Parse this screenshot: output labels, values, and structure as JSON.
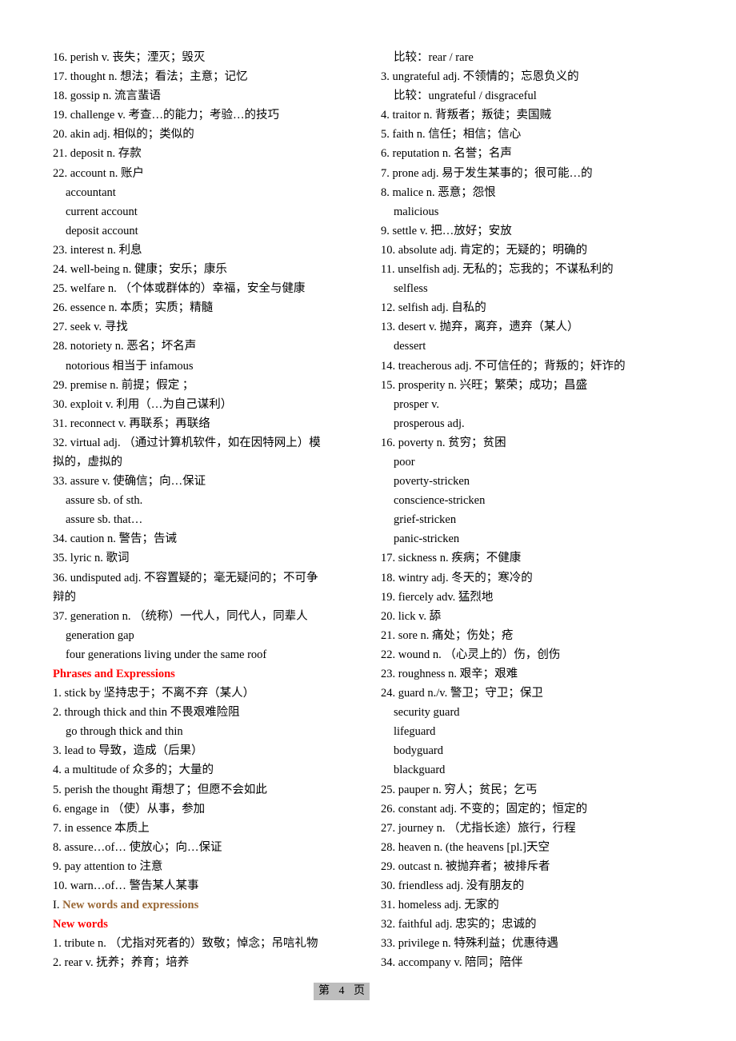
{
  "left_column": [
    {
      "type": "entry",
      "text": "16. perish v.  丧失；湮灭；毁灭"
    },
    {
      "type": "entry",
      "text": "17. thought n.  想法；看法；主意；记忆"
    },
    {
      "type": "entry",
      "text": "18. gossip n.  流言蜚语"
    },
    {
      "type": "entry",
      "text": "19. challenge v.  考查…的能力；考验…的技巧"
    },
    {
      "type": "entry",
      "text": "20. akin adj.  相似的；类似的"
    },
    {
      "type": "entry",
      "text": "21. deposit n.  存款"
    },
    {
      "type": "entry",
      "text": "22. account n.  账户"
    },
    {
      "type": "sub",
      "text": "accountant"
    },
    {
      "type": "sub",
      "text": "current account"
    },
    {
      "type": "sub",
      "text": "deposit account"
    },
    {
      "type": "entry",
      "text": "23. interest n.  利息"
    },
    {
      "type": "entry",
      "text": "24. well-being n.  健康；安乐；康乐"
    },
    {
      "type": "entry",
      "text": "25. welfare n.  （个体或群体的）幸福，安全与健康"
    },
    {
      "type": "entry",
      "text": "26. essence n.  本质；实质；精髓"
    },
    {
      "type": "entry",
      "text": "27. seek v.  寻找"
    },
    {
      "type": "entry",
      "text": "28. notoriety n.  恶名；坏名声"
    },
    {
      "type": "sub",
      "text": "notorious  相当于 infamous"
    },
    {
      "type": "entry",
      "text": "29. premise n.  前提；假定  ；"
    },
    {
      "type": "entry",
      "text": "30. exploit v.  利用（…为自己谋利）"
    },
    {
      "type": "entry",
      "text": "31. reconnect v.  再联系；再联络"
    },
    {
      "type": "entry",
      "text": "32. virtual adj.  （通过计算机软件，如在因特网上）模"
    },
    {
      "type": "cont",
      "text": "拟的，虚拟的"
    },
    {
      "type": "entry",
      "text": "33. assure v.  使确信；向…保证"
    },
    {
      "type": "sub",
      "text": "assure sb. of sth."
    },
    {
      "type": "sub",
      "text": "assure sb. that…"
    },
    {
      "type": "entry",
      "text": "34. caution n.  警告；告诫"
    },
    {
      "type": "entry",
      "text": "35. lyric n.  歌词"
    },
    {
      "type": "entry",
      "text": "36. undisputed adj.  不容置疑的；毫无疑问的；不可争"
    },
    {
      "type": "cont",
      "text": "辩的"
    },
    {
      "type": "entry",
      "text": "37. generation n.  （统称）一代人，同代人，同辈人"
    },
    {
      "type": "sub",
      "text": "generation gap"
    },
    {
      "type": "sub",
      "text": "four generations living under the same roof"
    },
    {
      "type": "heading-red",
      "text": "Phrases and Expressions"
    },
    {
      "type": "entry",
      "text": "1. stick by  坚持忠于；不离不弃（某人）"
    },
    {
      "type": "entry",
      "text": "2. through thick and thin  不畏艰难险阻"
    },
    {
      "type": "sub",
      "text": "go through thick and thin"
    },
    {
      "type": "entry",
      "text": "3. lead to  导致，造成（后果）"
    },
    {
      "type": "entry",
      "text": "4. a multitude of  众多的；大量的"
    },
    {
      "type": "entry",
      "text": "5. perish the thought  甭想了；但愿不会如此"
    },
    {
      "type": "entry",
      "text": "6. engage in  （使）从事，参加"
    },
    {
      "type": "entry",
      "text": "7. in essence  本质上"
    },
    {
      "type": "entry",
      "text": "8. assure…of…  使放心；向…保证"
    },
    {
      "type": "entry",
      "text": "9. pay attention to  注意"
    },
    {
      "type": "entry",
      "text": "10. warn…of…  警告某人某事"
    },
    {
      "type": "heading-brown",
      "prefix": "I. ",
      "text": "New words and expressions"
    },
    {
      "type": "heading-red",
      "text": "New words"
    },
    {
      "type": "entry",
      "text": "1. tribute n.  （尤指对死者的）致敬；悼念；吊唁礼物"
    },
    {
      "type": "entry",
      "text": "2. rear v.  抚养；养育；培养"
    }
  ],
  "right_column": [
    {
      "type": "sub",
      "text": "比较：rear / rare"
    },
    {
      "type": "entry",
      "text": "3. ungrateful adj.  不领情的；忘恩负义的"
    },
    {
      "type": "sub",
      "text": "比较：ungrateful / disgraceful"
    },
    {
      "type": "entry",
      "text": "4. traitor n.  背叛者；叛徒；卖国贼"
    },
    {
      "type": "entry",
      "text": "5. faith n.  信任；相信；信心"
    },
    {
      "type": "entry",
      "text": "6. reputation n.  名誉；名声"
    },
    {
      "type": "entry",
      "text": "7. prone adj.  易于发生某事的；很可能…的"
    },
    {
      "type": "entry",
      "text": "8. malice n.  恶意；怨恨"
    },
    {
      "type": "sub",
      "text": "malicious"
    },
    {
      "type": "entry",
      "text": "9. settle v.  把…放好；安放"
    },
    {
      "type": "entry",
      "text": "10. absolute adj.  肯定的；无疑的；明确的"
    },
    {
      "type": "entry",
      "text": "11. unselfish adj.  无私的；忘我的；不谋私利的"
    },
    {
      "type": "sub",
      "text": "selfless"
    },
    {
      "type": "entry",
      "text": "12. selfish adj.  自私的"
    },
    {
      "type": "entry",
      "text": "13. desert v.  抛弃，离弃，遗弃（某人）"
    },
    {
      "type": "sub",
      "text": "dessert"
    },
    {
      "type": "entry",
      "text": "14. treacherous adj.  不可信任的；背叛的；奸诈的"
    },
    {
      "type": "entry",
      "text": "15. prosperity n.  兴旺；繁荣；成功；昌盛"
    },
    {
      "type": "sub",
      "text": "prosper v."
    },
    {
      "type": "sub",
      "text": "prosperous adj."
    },
    {
      "type": "entry",
      "text": "16. poverty n.  贫穷；贫困"
    },
    {
      "type": "sub",
      "text": "poor"
    },
    {
      "type": "sub",
      "text": "poverty-stricken"
    },
    {
      "type": "sub",
      "text": "conscience-stricken"
    },
    {
      "type": "sub",
      "text": "grief-stricken"
    },
    {
      "type": "sub",
      "text": "panic-stricken"
    },
    {
      "type": "entry",
      "text": "17. sickness n.  疾病；不健康"
    },
    {
      "type": "entry",
      "text": "18. wintry adj.  冬天的；寒冷的"
    },
    {
      "type": "entry",
      "text": "19. fiercely adv.  猛烈地"
    },
    {
      "type": "entry",
      "text": "20. lick v.  舔"
    },
    {
      "type": "entry",
      "text": "21. sore n.  痛处；伤处；疮"
    },
    {
      "type": "entry",
      "text": "22. wound n.  （心灵上的）伤，创伤"
    },
    {
      "type": "entry",
      "text": "23. roughness n.  艰辛；艰难"
    },
    {
      "type": "entry",
      "text": "24. guard n./v.  警卫；守卫；保卫"
    },
    {
      "type": "sub",
      "text": "security guard"
    },
    {
      "type": "sub",
      "text": "lifeguard"
    },
    {
      "type": "sub",
      "text": "bodyguard"
    },
    {
      "type": "sub",
      "text": "blackguard"
    },
    {
      "type": "entry",
      "text": "25. pauper n.  穷人；贫民；乞丐"
    },
    {
      "type": "entry",
      "text": "26. constant adj.  不变的；固定的；恒定的"
    },
    {
      "type": "entry",
      "text": "27. journey n.  （尤指长途）旅行，行程"
    },
    {
      "type": "entry",
      "text": "28. heaven n. (the heavens [pl.]天空"
    },
    {
      "type": "entry",
      "text": "29. outcast n.  被抛弃者；被排斥者"
    },
    {
      "type": "entry",
      "text": "30. friendless adj.  没有朋友的"
    },
    {
      "type": "entry",
      "text": "31. homeless adj.  无家的"
    },
    {
      "type": "entry",
      "text": "32. faithful adj.  忠实的；忠诚的"
    },
    {
      "type": "entry",
      "text": "33. privilege n.  特殊利益；优惠待遇"
    },
    {
      "type": "entry",
      "text": "34. accompany v.  陪同；陪伴"
    }
  ],
  "footer": {
    "prefix": "第",
    "page_number": "4",
    "suffix": "页"
  },
  "colors": {
    "heading_red": "#ff0000",
    "heading_brown": "#996633",
    "footer_bg": "#bdbdbd"
  }
}
